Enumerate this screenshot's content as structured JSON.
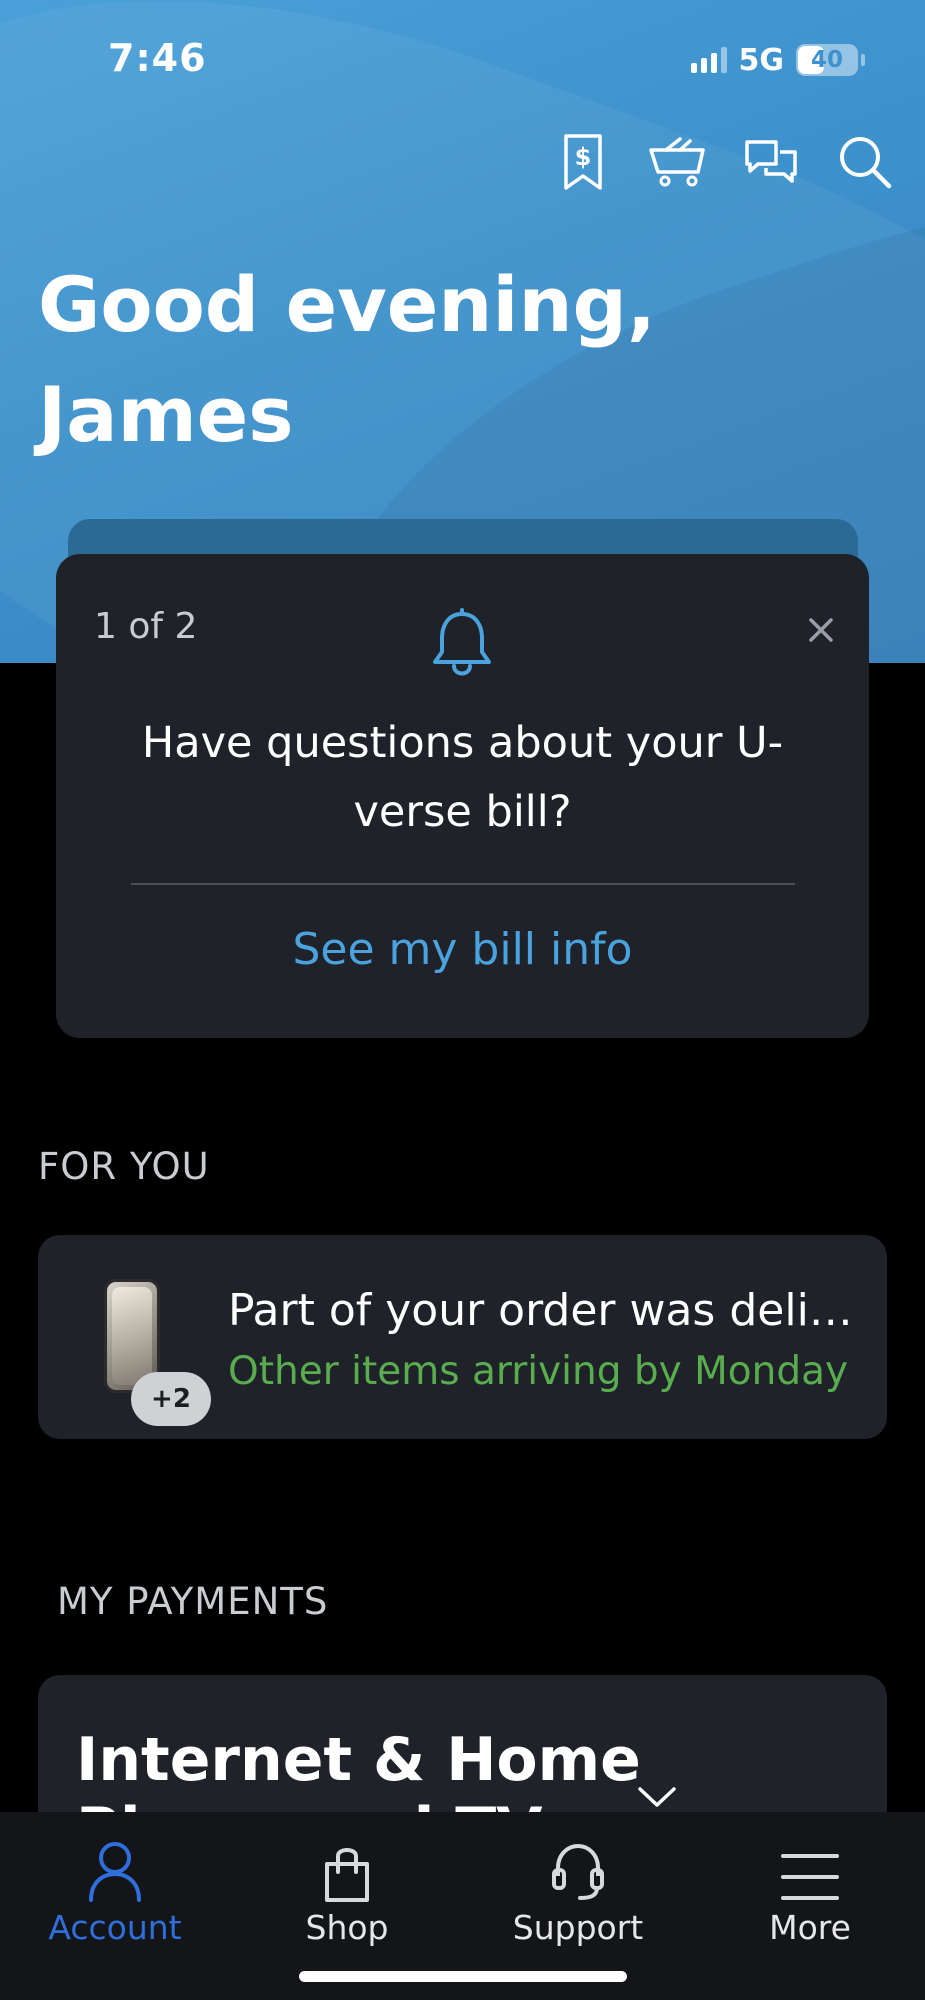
{
  "status_bar": {
    "time": "7:46",
    "network": "5G",
    "battery": "40"
  },
  "header_icons": [
    "bill-icon",
    "cart-icon",
    "chat-icon",
    "search-icon"
  ],
  "greeting": {
    "line1": "Good evening,",
    "line2": "James"
  },
  "notification": {
    "count": "1 of 2",
    "message": "Have questions about your U-verse bill?",
    "link": "See my bill info"
  },
  "for_you": {
    "label": "FOR YOU",
    "order": {
      "title": "Part of your order was deli…",
      "subtitle": "Other items arriving by Monday",
      "badge": "+2"
    }
  },
  "payments": {
    "label": "MY PAYMENTS",
    "card_title": "Internet & Home Phone and TV"
  },
  "tabs": [
    {
      "label": "Account",
      "icon": "person-icon",
      "active": true
    },
    {
      "label": "Shop",
      "icon": "bag-icon",
      "active": false
    },
    {
      "label": "Support",
      "icon": "headset-icon",
      "active": false
    },
    {
      "label": "More",
      "icon": "menu-icon",
      "active": false
    }
  ],
  "colors": {
    "accent_blue": "#4aa3df",
    "success_green": "#5aad4e",
    "active_tab": "#2f6fdc",
    "card_bg": "#1f2229"
  }
}
